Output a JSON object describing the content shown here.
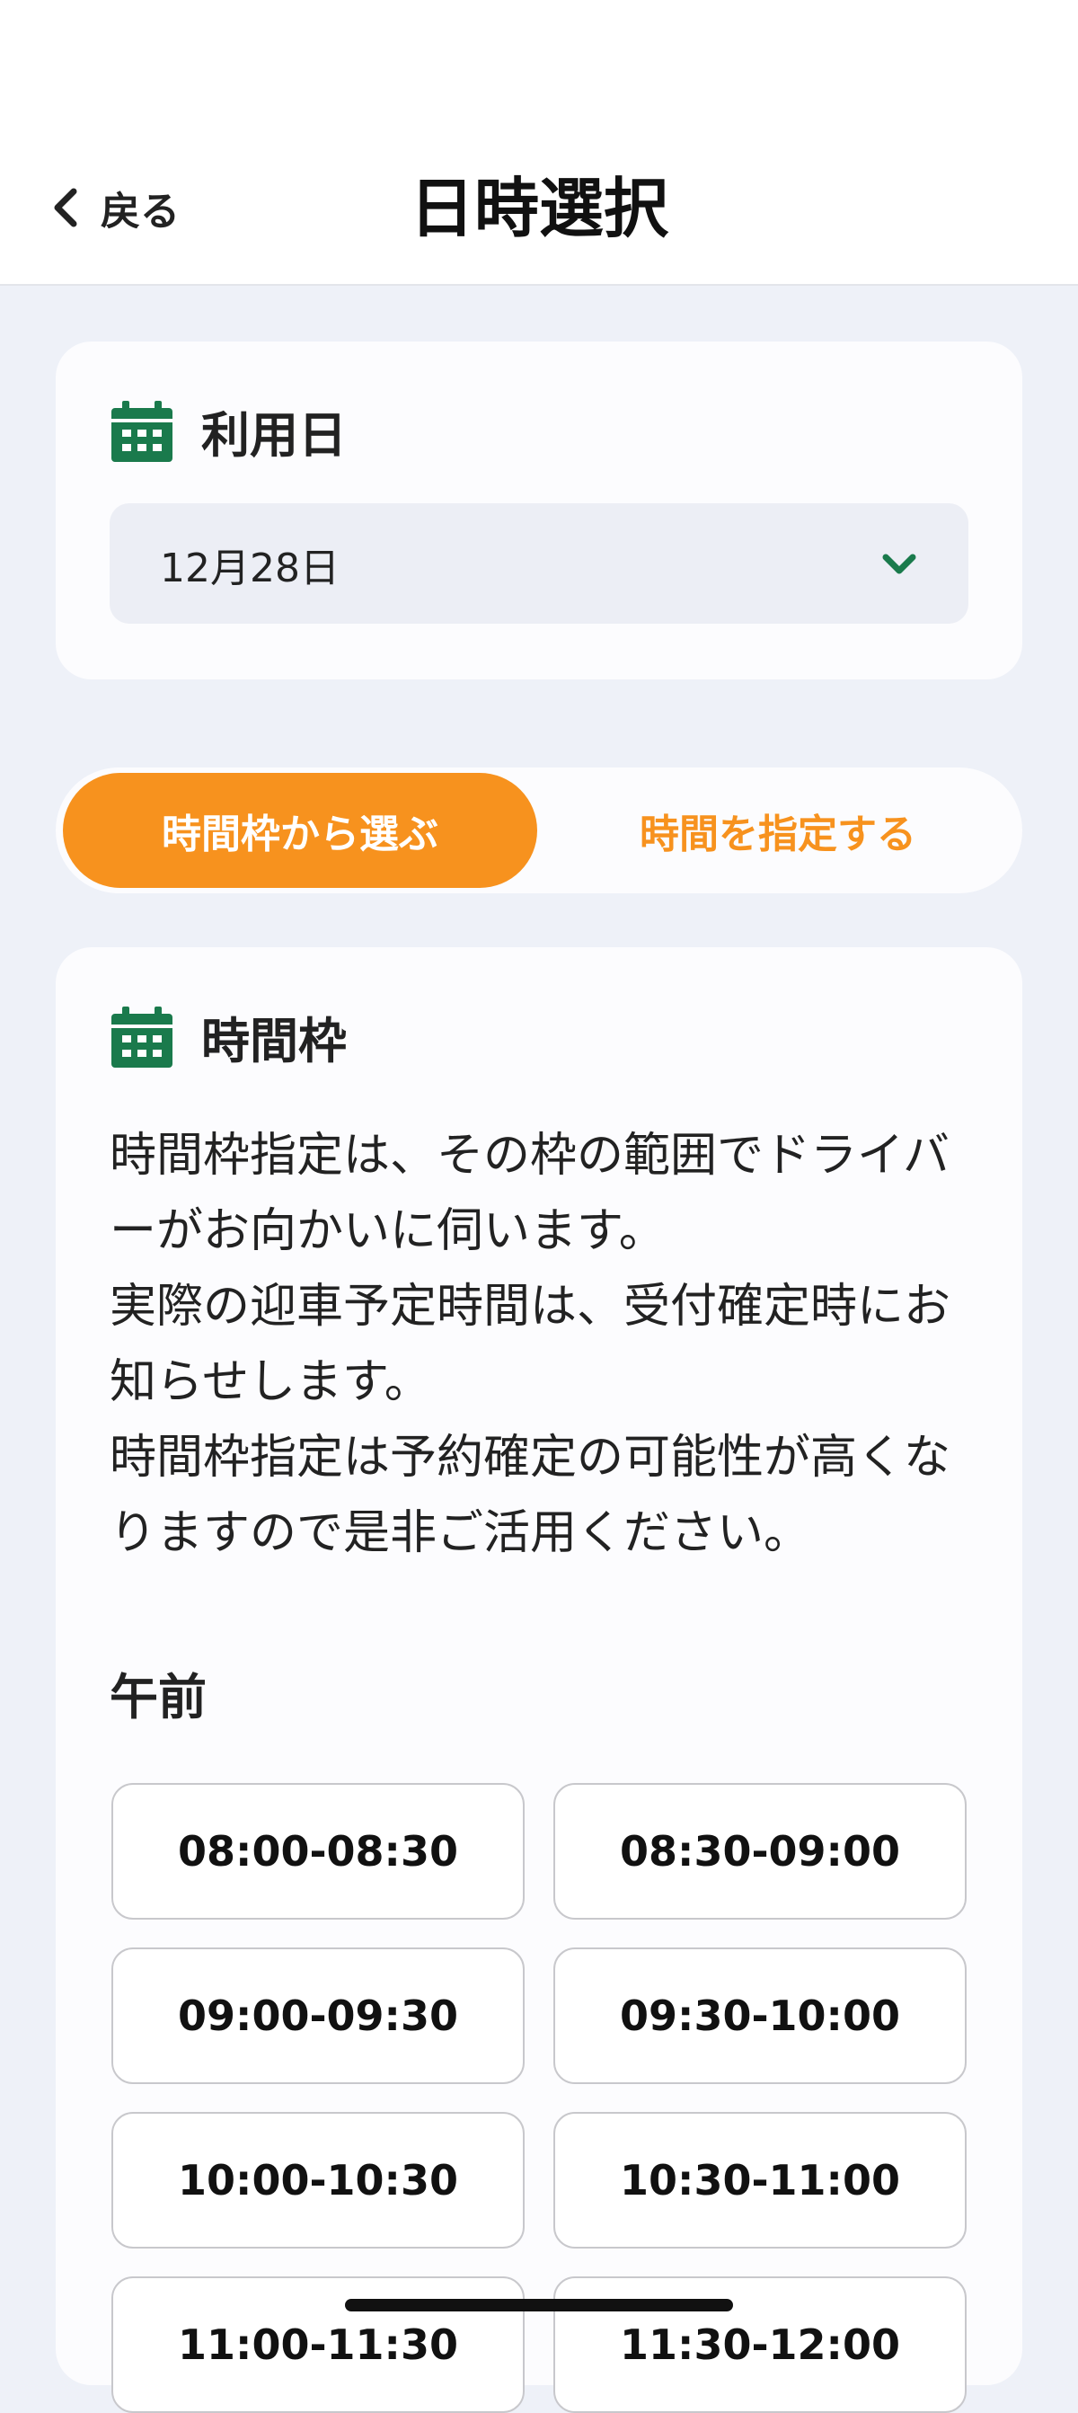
{
  "header": {
    "back_label": "戻る",
    "title": "日時選択"
  },
  "date_card": {
    "icon": "calendar-icon",
    "label": "利用日",
    "selected_date": "12月28日"
  },
  "mode_toggle": {
    "active_label": "時間枠から選ぶ",
    "inactive_label": "時間を指定する"
  },
  "slots_card": {
    "icon": "calendar-icon",
    "label": "時間枠",
    "notice": [
      "時間枠指定は、その枠の範囲でドライバーがお向かいに伺います。",
      " 実際の迎車予定時間は、受付確定時にお知らせします。",
      " 時間枠指定は予約確定の可能性が高くなりますので是非ご活用ください。"
    ],
    "morning_label": "午前",
    "slots": [
      "08:00-08:30",
      "08:30-09:00",
      "09:00-09:30",
      "09:30-10:00",
      "10:00-10:30",
      "10:30-11:00",
      "11:00-11:30",
      "11:30-12:00"
    ]
  },
  "colors": {
    "accent_orange": "#f7921e",
    "icon_green": "#1a7a4c",
    "background": "#eef1f8"
  }
}
